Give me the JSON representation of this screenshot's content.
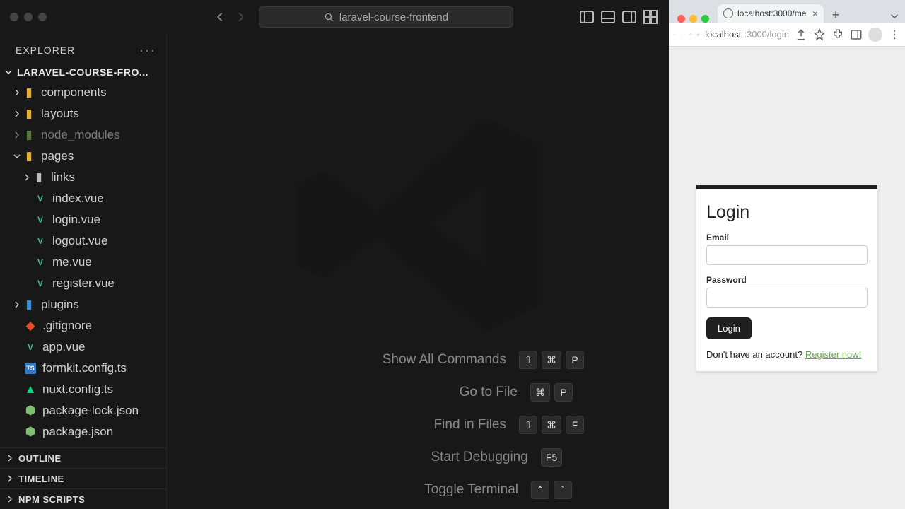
{
  "vscode": {
    "project_name": "laravel-course-frontend",
    "explorer_title": "EXPLORER",
    "project_label": "LARAVEL-COURSE-FRO...",
    "tree": {
      "components": "components",
      "layouts": "layouts",
      "node_modules": "node_modules",
      "pages": "pages",
      "links": "links",
      "index": "index.vue",
      "login": "login.vue",
      "logout": "logout.vue",
      "me": "me.vue",
      "register": "register.vue",
      "plugins": "plugins",
      "gitignore": ".gitignore",
      "app": "app.vue",
      "formkit": "formkit.config.ts",
      "nuxt": "nuxt.config.ts",
      "pkglock": "package-lock.json",
      "pkg": "package.json"
    },
    "sections": {
      "outline": "OUTLINE",
      "timeline": "TIMELINE",
      "npm": "NPM SCRIPTS"
    },
    "shortcuts": {
      "all_commands": "Show All Commands",
      "all_commands_keys": [
        "⇧",
        "⌘",
        "P"
      ],
      "go_to_file": "Go to File",
      "go_to_file_keys": [
        "⌘",
        "P"
      ],
      "find_in_files": "Find in Files",
      "find_in_files_keys": [
        "⇧",
        "⌘",
        "F"
      ],
      "start_debug": "Start Debugging",
      "start_debug_keys": [
        "F5"
      ],
      "toggle_terminal": "Toggle Terminal",
      "toggle_terminal_keys": [
        "⌃",
        "`"
      ]
    }
  },
  "chrome": {
    "tab_title": "localhost:3000/me",
    "url_host": "localhost",
    "url_rest": ":3000/login"
  },
  "login_page": {
    "heading": "Login",
    "email_label": "Email",
    "password_label": "Password",
    "submit": "Login",
    "no_account": "Don't have an account? ",
    "register_link": "Register now!"
  }
}
